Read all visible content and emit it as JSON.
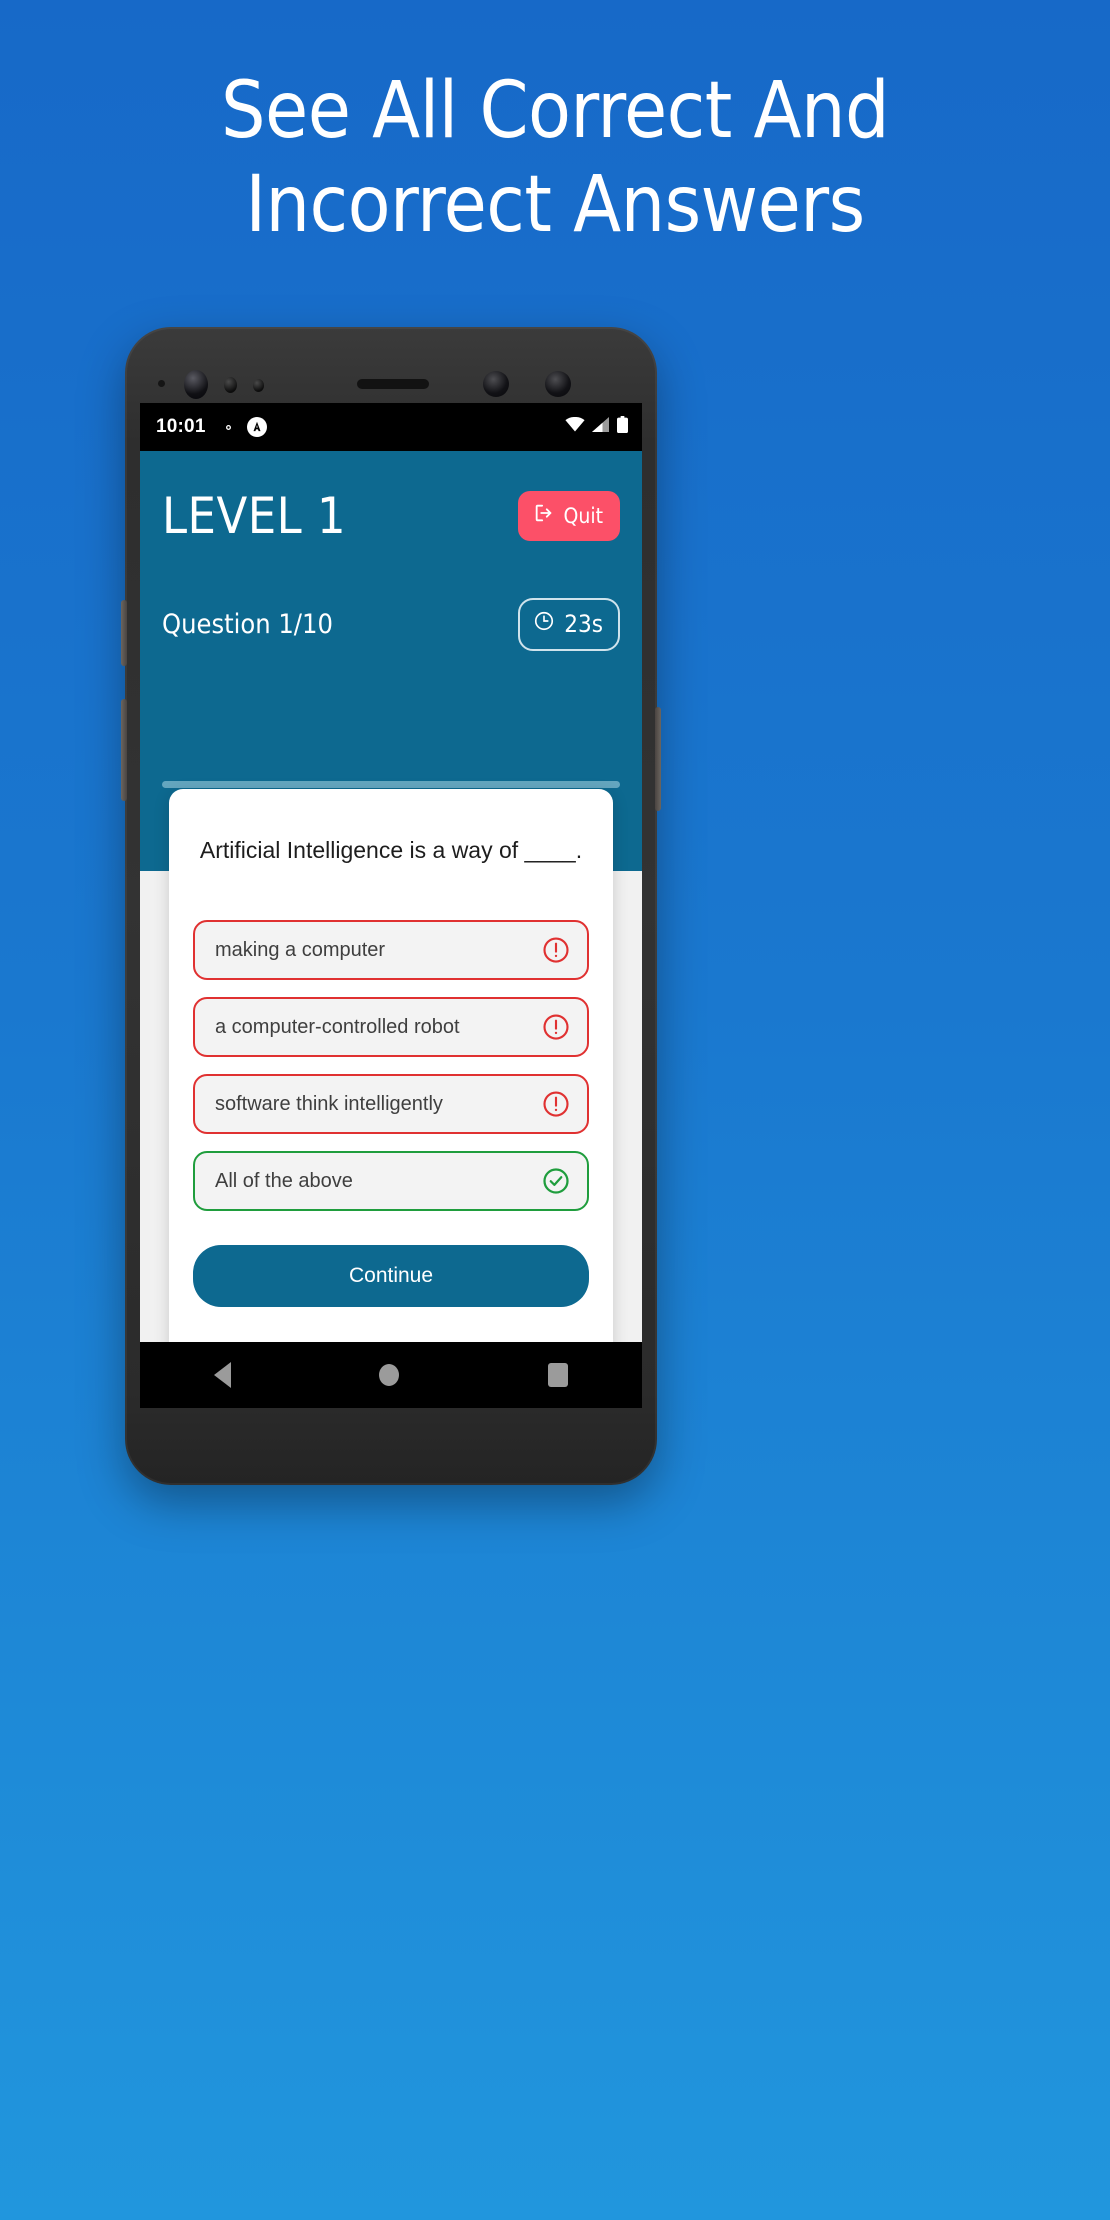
{
  "promo": {
    "headline_line1": "See All Correct And",
    "headline_line2": "Incorrect Answers"
  },
  "colors": {
    "bg_top": "#1769c8",
    "bg_bottom": "#2196dd",
    "app_header": "#0d6990",
    "quit_button": "#fc5068",
    "correct": "#1f9d3d",
    "incorrect": "#e03131",
    "continue_button": "#0d6990"
  },
  "status_bar": {
    "time": "10:01",
    "left_icons": [
      "gear-icon",
      "app-badge-icon"
    ],
    "right_icons": [
      "wifi-icon",
      "cellular-signal-icon",
      "battery-icon"
    ]
  },
  "app_header": {
    "level_title": "LEVEL 1",
    "quit_label": "Quit",
    "quit_icon": "logout-icon",
    "question_counter": "Question 1/10",
    "timer_value": "23s",
    "timer_icon": "clock-icon",
    "progress_percent": 0
  },
  "question_card": {
    "question_text": "Artificial Intelligence is a way of ____.",
    "options": [
      {
        "label": "making a computer",
        "state": "incorrect",
        "icon": "exclamation-circle-icon"
      },
      {
        "label": "a computer-controlled robot",
        "state": "incorrect",
        "icon": "exclamation-circle-icon"
      },
      {
        "label": "software think intelligently",
        "state": "incorrect",
        "icon": "exclamation-circle-icon"
      },
      {
        "label": "All of the above",
        "state": "correct",
        "icon": "check-circle-icon"
      }
    ],
    "continue_label": "Continue"
  },
  "nav_bar": {
    "back_label": "Back",
    "home_label": "Home",
    "recents_label": "Recents"
  }
}
